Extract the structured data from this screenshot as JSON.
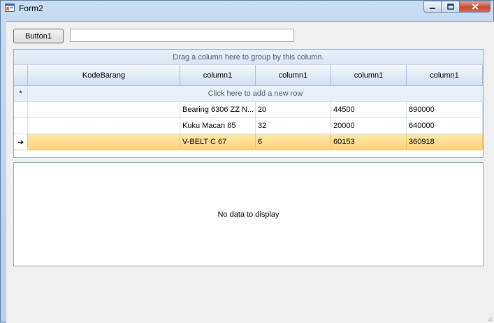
{
  "window": {
    "title": "Form2",
    "controls": {
      "minimize": "minimize-icon",
      "maximize": "maximize-icon",
      "close": "close-icon"
    }
  },
  "toolbar": {
    "button1_label": "Button1",
    "textbox_value": ""
  },
  "grid": {
    "group_by_text": "Drag a column here to group by this column.",
    "columns": [
      "KodeBarang",
      "column1",
      "column1",
      "column1",
      "column1"
    ],
    "new_row_marker": "*",
    "new_row_text": "Click here to add a new row",
    "rows": [
      {
        "cells": [
          "",
          "Bearing 6306 ZZ N...",
          "20",
          "44500",
          "890000"
        ],
        "current": false
      },
      {
        "cells": [
          "",
          "Kuku Macan 65",
          "32",
          "20000",
          "640000"
        ],
        "current": false
      },
      {
        "cells": [
          "",
          "V-BELT C 67",
          "6",
          "60153",
          "360918"
        ],
        "current": true
      }
    ],
    "current_row_indicator": "➔",
    "colors": {
      "current_row": "#fdd27a",
      "header": "#dde8f5",
      "border": "#8ea9c8"
    }
  },
  "detail": {
    "empty_text": "No data to display"
  }
}
